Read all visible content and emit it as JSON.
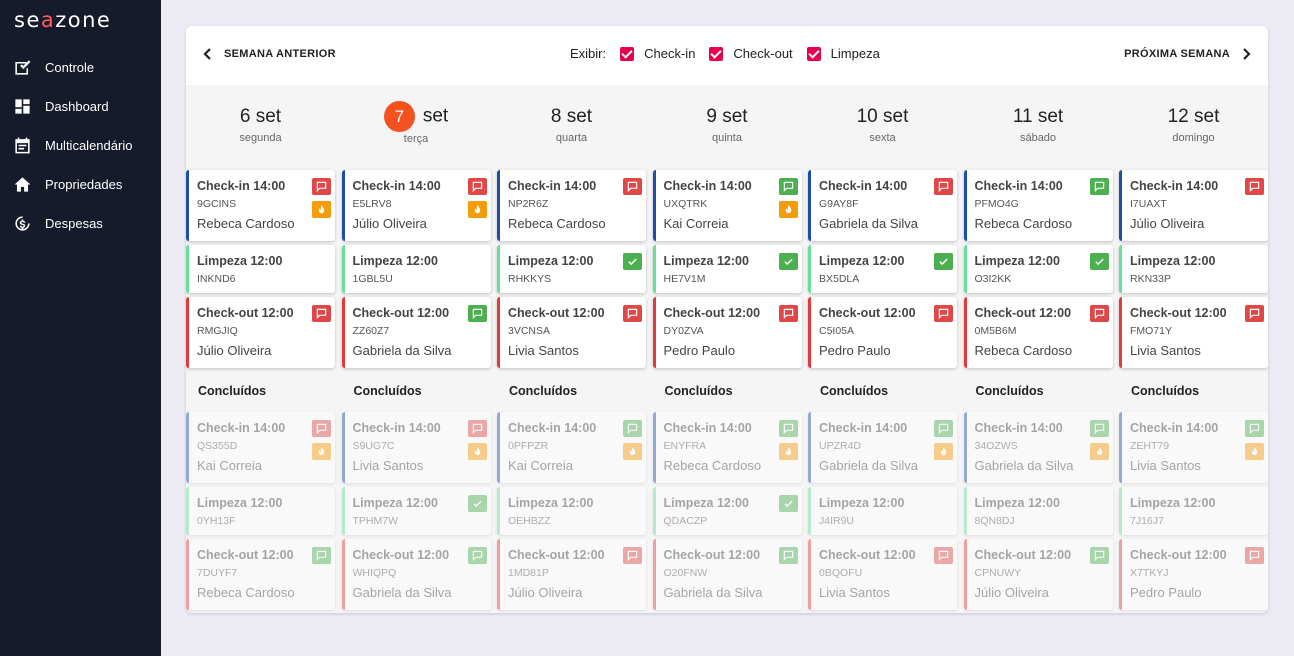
{
  "app": {
    "logo_pre": "se",
    "logo_a": "a",
    "logo_post": "zone"
  },
  "sidebar": {
    "items": [
      {
        "label": "Controle",
        "icon": "checklist-icon"
      },
      {
        "label": "Dashboard",
        "icon": "dashboard-icon"
      },
      {
        "label": "Multicalendário",
        "icon": "calendar-icon"
      },
      {
        "label": "Propriedades",
        "icon": "home-icon"
      },
      {
        "label": "Despesas",
        "icon": "expenses-icon"
      }
    ]
  },
  "toolbar": {
    "prev_label": "SEMANA ANTERIOR",
    "next_label": "PRÓXIMA SEMANA",
    "filter_label": "Exibir:",
    "filters": [
      "Check-in",
      "Check-out",
      "Limpeza"
    ]
  },
  "colors": {
    "checkin": "#1e4fa8",
    "cleaning": "#69e09a",
    "checkout": "#e23b3b",
    "msg_red": "#e04848",
    "msg_green": "#4caf50",
    "fire": "#f59c0b",
    "today": "#f4511e"
  },
  "done_label": "Concluídos",
  "days": [
    {
      "num": "6 set",
      "name": "segunda",
      "today": false,
      "active": [
        {
          "type": "checkin",
          "title": "Check-in 14:00",
          "code": "9GCINS",
          "name": "Rebeca Cardoso",
          "msg": "red",
          "fire": true
        },
        {
          "type": "clean",
          "title": "Limpeza 12:00",
          "code": "INKND6",
          "check": false
        },
        {
          "type": "checkout",
          "title": "Check-out 12:00",
          "code": "RMGJIQ",
          "name": "Júlio Oliveira",
          "msg": "red"
        }
      ],
      "done": [
        {
          "type": "checkin",
          "title": "Check-in 14:00",
          "code": "QS355D",
          "name": "Kai Correia",
          "msg": "red",
          "fire": true
        },
        {
          "type": "clean",
          "title": "Limpeza 12:00",
          "code": "0YH13F",
          "check": false
        },
        {
          "type": "checkout",
          "title": "Check-out 12:00",
          "code": "7DUYF7",
          "name": "Rebeca Cardoso",
          "msg": "green"
        }
      ]
    },
    {
      "num": "set",
      "circle": "7",
      "name": "terça",
      "today": true,
      "active": [
        {
          "type": "checkin",
          "title": "Check-in 14:00",
          "code": "E5LRV8",
          "name": "Júlio Oliveira",
          "msg": "red",
          "fire": true
        },
        {
          "type": "clean",
          "title": "Limpeza 12:00",
          "code": "1GBL5U",
          "check": false
        },
        {
          "type": "checkout",
          "title": "Check-out 12:00",
          "code": "ZZ60Z7",
          "name": "Gabriela da Silva",
          "msg": "green"
        }
      ],
      "done": [
        {
          "type": "checkin",
          "title": "Check-in 14:00",
          "code": "S9UG7C",
          "name": "Livia Santos",
          "msg": "red",
          "fire": true
        },
        {
          "type": "clean",
          "title": "Limpeza 12:00",
          "code": "TPHM7W",
          "check": true
        },
        {
          "type": "checkout",
          "title": "Check-out 12:00",
          "code": "WHIQPQ",
          "name": "Gabriela da Silva",
          "msg": "green"
        }
      ]
    },
    {
      "num": "8 set",
      "name": "quarta",
      "today": false,
      "active": [
        {
          "type": "checkin",
          "title": "Check-in 14:00",
          "code": "NP2R6Z",
          "name": "Rebeca Cardoso",
          "msg": "red",
          "fire": false
        },
        {
          "type": "clean",
          "title": "Limpeza 12:00",
          "code": "RHKKYS",
          "check": true
        },
        {
          "type": "checkout",
          "title": "Check-out 12:00",
          "code": "3VCNSA",
          "name": "Livia Santos",
          "msg": "red"
        }
      ],
      "done": [
        {
          "type": "checkin",
          "title": "Check-in 14:00",
          "code": "0PFPZR",
          "name": "Kai Correia",
          "msg": "green",
          "fire": true
        },
        {
          "type": "clean",
          "title": "Limpeza 12:00",
          "code": "OEHBZZ",
          "check": false
        },
        {
          "type": "checkout",
          "title": "Check-out 12:00",
          "code": "1MD81P",
          "name": "Júlio Oliveira",
          "msg": "red"
        }
      ]
    },
    {
      "num": "9 set",
      "name": "quinta",
      "today": false,
      "active": [
        {
          "type": "checkin",
          "title": "Check-in 14:00",
          "code": "UXQTRK",
          "name": "Kai Correia",
          "msg": "green",
          "fire": true
        },
        {
          "type": "clean",
          "title": "Limpeza 12:00",
          "code": "HE7V1M",
          "check": true
        },
        {
          "type": "checkout",
          "title": "Check-out 12:00",
          "code": "DY0ZVA",
          "name": "Pedro Paulo",
          "msg": "red"
        }
      ],
      "done": [
        {
          "type": "checkin",
          "title": "Check-in 14:00",
          "code": "ENYFRA",
          "name": "Rebeca Cardoso",
          "msg": "green",
          "fire": true
        },
        {
          "type": "clean",
          "title": "Limpeza 12:00",
          "code": "QDACZP",
          "check": true
        },
        {
          "type": "checkout",
          "title": "Check-out 12:00",
          "code": "O20FNW",
          "name": "Gabriela da Silva",
          "msg": "green"
        }
      ]
    },
    {
      "num": "10 set",
      "name": "sexta",
      "today": false,
      "active": [
        {
          "type": "checkin",
          "title": "Check-in 14:00",
          "code": "G9AY8F",
          "name": "Gabriela da Silva",
          "msg": "red",
          "fire": false
        },
        {
          "type": "clean",
          "title": "Limpeza 12:00",
          "code": "BX5DLA",
          "check": true
        },
        {
          "type": "checkout",
          "title": "Check-out 12:00",
          "code": "C5I05A",
          "name": "Pedro Paulo",
          "msg": "red"
        }
      ],
      "done": [
        {
          "type": "checkin",
          "title": "Check-in 14:00",
          "code": "UPZR4D",
          "name": "Gabriela da Silva",
          "msg": "green",
          "fire": true
        },
        {
          "type": "clean",
          "title": "Limpeza 12:00",
          "code": "J4IR9U",
          "check": false
        },
        {
          "type": "checkout",
          "title": "Check-out 12:00",
          "code": "0BQOFU",
          "name": "Livia Santos",
          "msg": "red"
        }
      ]
    },
    {
      "num": "11 set",
      "name": "sábado",
      "today": false,
      "active": [
        {
          "type": "checkin",
          "title": "Check-in 14:00",
          "code": "PFMO4G",
          "name": "Rebeca Cardoso",
          "msg": "green",
          "fire": false
        },
        {
          "type": "clean",
          "title": "Limpeza 12:00",
          "code": "O3I2KK",
          "check": true
        },
        {
          "type": "checkout",
          "title": "Check-out 12:00",
          "code": "0M5B6M",
          "name": "Rebeca Cardoso",
          "msg": "red"
        }
      ],
      "done": [
        {
          "type": "checkin",
          "title": "Check-in 14:00",
          "code": "34OZWS",
          "name": "Gabriela da Silva",
          "msg": "green",
          "fire": true
        },
        {
          "type": "clean",
          "title": "Limpeza 12:00",
          "code": "8QN8DJ",
          "check": false
        },
        {
          "type": "checkout",
          "title": "Check-out 12:00",
          "code": "CPNUWY",
          "name": "Júlio Oliveira",
          "msg": "green"
        }
      ]
    },
    {
      "num": "12 set",
      "name": "domingo",
      "today": false,
      "active": [
        {
          "type": "checkin",
          "title": "Check-in 14:00",
          "code": "I7UAXT",
          "name": "Júlio Oliveira",
          "msg": "red",
          "fire": false
        },
        {
          "type": "clean",
          "title": "Limpeza 12:00",
          "code": "RKN33P",
          "check": false
        },
        {
          "type": "checkout",
          "title": "Check-out 12:00",
          "code": "FMO71Y",
          "name": "Livia Santos",
          "msg": "red"
        }
      ],
      "done": [
        {
          "type": "checkin",
          "title": "Check-in 14:00",
          "code": "ZEHT79",
          "name": "Livia Santos",
          "msg": "green",
          "fire": true
        },
        {
          "type": "clean",
          "title": "Limpeza 12:00",
          "code": "7J16J7",
          "check": false
        },
        {
          "type": "checkout",
          "title": "Check-out 12:00",
          "code": "X7TKYJ",
          "name": "Pedro Paulo",
          "msg": "red"
        }
      ]
    }
  ]
}
